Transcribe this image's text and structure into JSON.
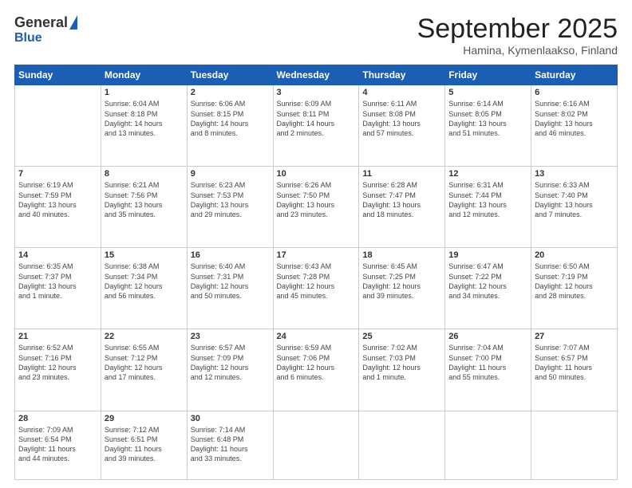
{
  "header": {
    "logo_general": "General",
    "logo_blue": "Blue",
    "title": "September 2025",
    "location": "Hamina, Kymenlaakso, Finland"
  },
  "days_of_week": [
    "Sunday",
    "Monday",
    "Tuesday",
    "Wednesday",
    "Thursday",
    "Friday",
    "Saturday"
  ],
  "weeks": [
    [
      {
        "day": "",
        "info": ""
      },
      {
        "day": "1",
        "info": "Sunrise: 6:04 AM\nSunset: 8:18 PM\nDaylight: 14 hours\nand 13 minutes."
      },
      {
        "day": "2",
        "info": "Sunrise: 6:06 AM\nSunset: 8:15 PM\nDaylight: 14 hours\nand 8 minutes."
      },
      {
        "day": "3",
        "info": "Sunrise: 6:09 AM\nSunset: 8:11 PM\nDaylight: 14 hours\nand 2 minutes."
      },
      {
        "day": "4",
        "info": "Sunrise: 6:11 AM\nSunset: 8:08 PM\nDaylight: 13 hours\nand 57 minutes."
      },
      {
        "day": "5",
        "info": "Sunrise: 6:14 AM\nSunset: 8:05 PM\nDaylight: 13 hours\nand 51 minutes."
      },
      {
        "day": "6",
        "info": "Sunrise: 6:16 AM\nSunset: 8:02 PM\nDaylight: 13 hours\nand 46 minutes."
      }
    ],
    [
      {
        "day": "7",
        "info": "Sunrise: 6:19 AM\nSunset: 7:59 PM\nDaylight: 13 hours\nand 40 minutes."
      },
      {
        "day": "8",
        "info": "Sunrise: 6:21 AM\nSunset: 7:56 PM\nDaylight: 13 hours\nand 35 minutes."
      },
      {
        "day": "9",
        "info": "Sunrise: 6:23 AM\nSunset: 7:53 PM\nDaylight: 13 hours\nand 29 minutes."
      },
      {
        "day": "10",
        "info": "Sunrise: 6:26 AM\nSunset: 7:50 PM\nDaylight: 13 hours\nand 23 minutes."
      },
      {
        "day": "11",
        "info": "Sunrise: 6:28 AM\nSunset: 7:47 PM\nDaylight: 13 hours\nand 18 minutes."
      },
      {
        "day": "12",
        "info": "Sunrise: 6:31 AM\nSunset: 7:44 PM\nDaylight: 13 hours\nand 12 minutes."
      },
      {
        "day": "13",
        "info": "Sunrise: 6:33 AM\nSunset: 7:40 PM\nDaylight: 13 hours\nand 7 minutes."
      }
    ],
    [
      {
        "day": "14",
        "info": "Sunrise: 6:35 AM\nSunset: 7:37 PM\nDaylight: 13 hours\nand 1 minute."
      },
      {
        "day": "15",
        "info": "Sunrise: 6:38 AM\nSunset: 7:34 PM\nDaylight: 12 hours\nand 56 minutes."
      },
      {
        "day": "16",
        "info": "Sunrise: 6:40 AM\nSunset: 7:31 PM\nDaylight: 12 hours\nand 50 minutes."
      },
      {
        "day": "17",
        "info": "Sunrise: 6:43 AM\nSunset: 7:28 PM\nDaylight: 12 hours\nand 45 minutes."
      },
      {
        "day": "18",
        "info": "Sunrise: 6:45 AM\nSunset: 7:25 PM\nDaylight: 12 hours\nand 39 minutes."
      },
      {
        "day": "19",
        "info": "Sunrise: 6:47 AM\nSunset: 7:22 PM\nDaylight: 12 hours\nand 34 minutes."
      },
      {
        "day": "20",
        "info": "Sunrise: 6:50 AM\nSunset: 7:19 PM\nDaylight: 12 hours\nand 28 minutes."
      }
    ],
    [
      {
        "day": "21",
        "info": "Sunrise: 6:52 AM\nSunset: 7:16 PM\nDaylight: 12 hours\nand 23 minutes."
      },
      {
        "day": "22",
        "info": "Sunrise: 6:55 AM\nSunset: 7:12 PM\nDaylight: 12 hours\nand 17 minutes."
      },
      {
        "day": "23",
        "info": "Sunrise: 6:57 AM\nSunset: 7:09 PM\nDaylight: 12 hours\nand 12 minutes."
      },
      {
        "day": "24",
        "info": "Sunrise: 6:59 AM\nSunset: 7:06 PM\nDaylight: 12 hours\nand 6 minutes."
      },
      {
        "day": "25",
        "info": "Sunrise: 7:02 AM\nSunset: 7:03 PM\nDaylight: 12 hours\nand 1 minute."
      },
      {
        "day": "26",
        "info": "Sunrise: 7:04 AM\nSunset: 7:00 PM\nDaylight: 11 hours\nand 55 minutes."
      },
      {
        "day": "27",
        "info": "Sunrise: 7:07 AM\nSunset: 6:57 PM\nDaylight: 11 hours\nand 50 minutes."
      }
    ],
    [
      {
        "day": "28",
        "info": "Sunrise: 7:09 AM\nSunset: 6:54 PM\nDaylight: 11 hours\nand 44 minutes."
      },
      {
        "day": "29",
        "info": "Sunrise: 7:12 AM\nSunset: 6:51 PM\nDaylight: 11 hours\nand 39 minutes."
      },
      {
        "day": "30",
        "info": "Sunrise: 7:14 AM\nSunset: 6:48 PM\nDaylight: 11 hours\nand 33 minutes."
      },
      {
        "day": "",
        "info": ""
      },
      {
        "day": "",
        "info": ""
      },
      {
        "day": "",
        "info": ""
      },
      {
        "day": "",
        "info": ""
      }
    ]
  ]
}
